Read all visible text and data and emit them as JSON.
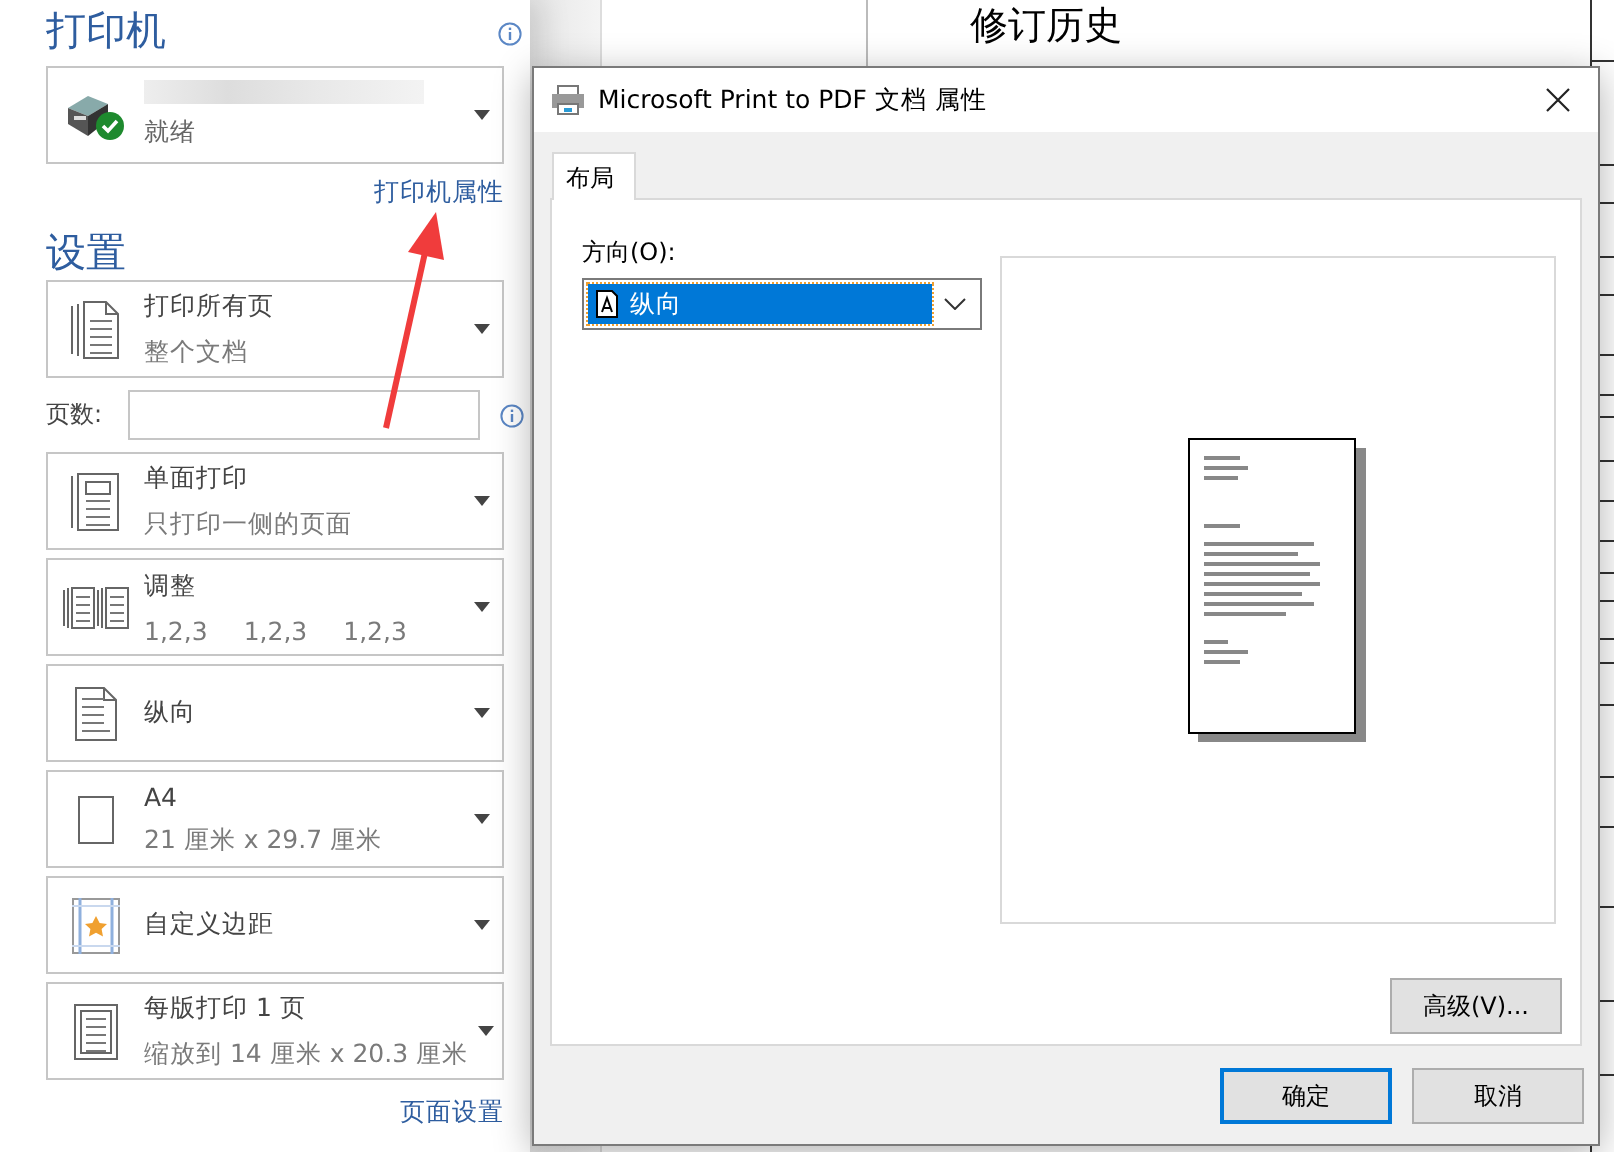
{
  "document": {
    "heading": "修订历史"
  },
  "backstage": {
    "printer_section": {
      "title": "打印机",
      "printer": {
        "status": "就绪"
      },
      "properties_link": "打印机属性"
    },
    "settings_section": {
      "title": "设置",
      "options": [
        {
          "kind": "pages",
          "title": "打印所有页",
          "subtitle": [
            "整个文档"
          ]
        },
        {
          "kind": "single-sided",
          "title": "单面打印",
          "subtitle": [
            "只打印一侧的页面"
          ]
        },
        {
          "kind": "collate",
          "title": "调整",
          "subtitle": [
            "1,2,3",
            "1,2,3",
            "1,2,3"
          ]
        },
        {
          "kind": "portrait",
          "title": "纵向"
        },
        {
          "kind": "paper",
          "title": "A4",
          "subtitle": [
            "21 厘米 x 29.7 厘米"
          ]
        },
        {
          "kind": "margins",
          "title": "自定义边距"
        },
        {
          "kind": "per-sheet",
          "title": "每版打印 1 页",
          "subtitle": [
            "缩放到 14 厘米 x 20.3 厘米"
          ]
        }
      ],
      "page_count": {
        "label": "页数:"
      },
      "page_setup_link": "页面设置"
    }
  },
  "dialog": {
    "title": "Microsoft Print to PDF 文档 属性",
    "tabs": [
      {
        "label": "布局",
        "selected": true
      }
    ],
    "orientation": {
      "label": "方向(O):",
      "value": "纵向"
    },
    "advanced_button": "高级(V)...",
    "buttons": [
      {
        "label": "确定",
        "default": true
      },
      {
        "label": "取消",
        "default": false
      }
    ]
  }
}
